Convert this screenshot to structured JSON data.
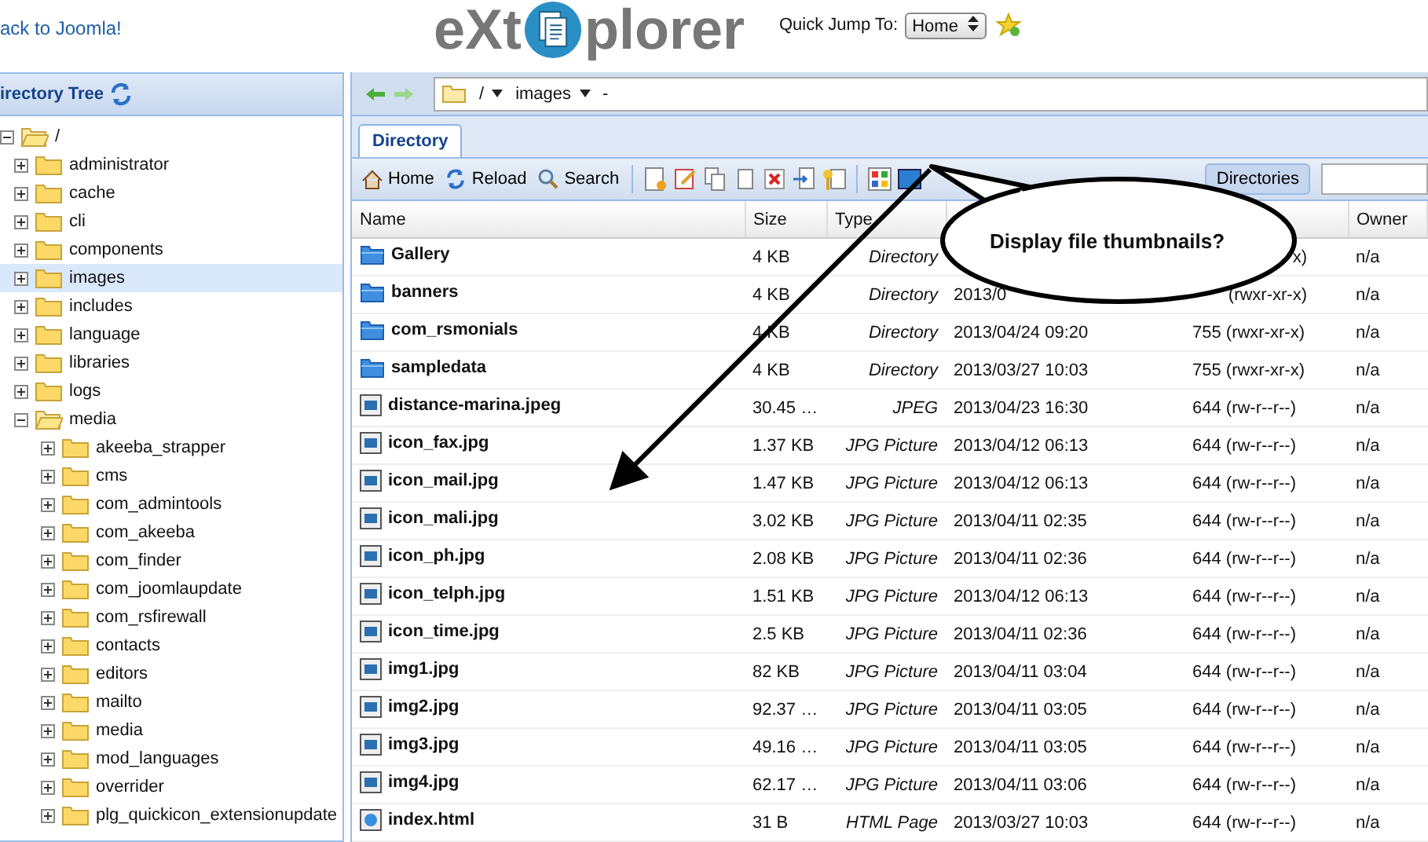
{
  "header": {
    "back_link": "ack to Joomla!",
    "logo_left": "eXt",
    "logo_right": "plorer",
    "quick_jump_label": "Quick Jump To:",
    "quick_jump_value": "Home"
  },
  "sidebar": {
    "title": "irectory Tree",
    "tree": {
      "label": "/",
      "expanded": true,
      "selected": false,
      "children": [
        {
          "label": "administrator",
          "expanded": false,
          "selected": false
        },
        {
          "label": "cache",
          "expanded": false,
          "selected": false
        },
        {
          "label": "cli",
          "expanded": false,
          "selected": false
        },
        {
          "label": "components",
          "expanded": false,
          "selected": false
        },
        {
          "label": "images",
          "expanded": false,
          "selected": true
        },
        {
          "label": "includes",
          "expanded": false,
          "selected": false
        },
        {
          "label": "language",
          "expanded": false,
          "selected": false
        },
        {
          "label": "libraries",
          "expanded": false,
          "selected": false
        },
        {
          "label": "logs",
          "expanded": false,
          "selected": false
        },
        {
          "label": "media",
          "expanded": true,
          "selected": false,
          "children": [
            {
              "label": "akeeba_strapper",
              "expanded": false,
              "selected": false
            },
            {
              "label": "cms",
              "expanded": false,
              "selected": false
            },
            {
              "label": "com_admintools",
              "expanded": false,
              "selected": false
            },
            {
              "label": "com_akeeba",
              "expanded": false,
              "selected": false
            },
            {
              "label": "com_finder",
              "expanded": false,
              "selected": false
            },
            {
              "label": "com_joomlaupdate",
              "expanded": false,
              "selected": false
            },
            {
              "label": "com_rsfirewall",
              "expanded": false,
              "selected": false
            },
            {
              "label": "contacts",
              "expanded": false,
              "selected": false
            },
            {
              "label": "editors",
              "expanded": false,
              "selected": false
            },
            {
              "label": "mailto",
              "expanded": false,
              "selected": false
            },
            {
              "label": "media",
              "expanded": false,
              "selected": false
            },
            {
              "label": "mod_languages",
              "expanded": false,
              "selected": false
            },
            {
              "label": "overrider",
              "expanded": false,
              "selected": false
            },
            {
              "label": "plg_quickicon_extensionupdate",
              "expanded": false,
              "selected": false
            }
          ]
        }
      ]
    }
  },
  "path_bar": {
    "segments": [
      "/",
      "images"
    ],
    "tail": "-"
  },
  "tabs": [
    {
      "label": "Directory",
      "selected": true
    }
  ],
  "toolbar": {
    "buttons": [
      "Home",
      "Reload",
      "Search"
    ],
    "toggle": "Directories"
  },
  "table": {
    "columns": {
      "name": "Name",
      "size": "Size",
      "type": "Type",
      "owner": "Owner"
    },
    "rows": [
      {
        "kind": "folder",
        "name": "Gallery",
        "size": "4 KB",
        "type": "Directory",
        "permissions": "x)",
        "permissions_cut": true,
        "owner": "n/a"
      },
      {
        "kind": "folder",
        "name": "banners",
        "size": "4 KB",
        "type": "Directory",
        "modified": "2013/0",
        "permissions": "(rwxr-xr-x)",
        "permissions_cut": true,
        "owner": "n/a"
      },
      {
        "kind": "folder",
        "name": "com_rsmonials",
        "size": "4 KB",
        "type": "Directory",
        "modified": "2013/04/24 09:20",
        "permissions": "755 (rwxr-xr-x)",
        "permissions_cut": false,
        "owner": "n/a"
      },
      {
        "kind": "folder",
        "name": "sampledata",
        "size": "4 KB",
        "type": "Directory",
        "modified": "2013/03/27 10:03",
        "permissions": "755 (rwxr-xr-x)",
        "permissions_cut": false,
        "owner": "n/a"
      },
      {
        "kind": "image",
        "name": "distance-marina.jpeg",
        "size": "30.45 …",
        "type": "JPEG",
        "modified": "2013/04/23 16:30",
        "permissions": "644 (rw-r--r--)",
        "permissions_cut": false,
        "owner": "n/a"
      },
      {
        "kind": "image",
        "name": "icon_fax.jpg",
        "size": "1.37 KB",
        "type": "JPG Picture",
        "modified": "2013/04/12 06:13",
        "permissions": "644 (rw-r--r--)",
        "permissions_cut": false,
        "owner": "n/a"
      },
      {
        "kind": "image",
        "name": "icon_mail.jpg",
        "size": "1.47 KB",
        "type": "JPG Picture",
        "modified": "2013/04/12 06:13",
        "permissions": "644 (rw-r--r--)",
        "permissions_cut": false,
        "owner": "n/a"
      },
      {
        "kind": "image",
        "name": "icon_mali.jpg",
        "size": "3.02 KB",
        "type": "JPG Picture",
        "modified": "2013/04/11 02:35",
        "permissions": "644 (rw-r--r--)",
        "permissions_cut": false,
        "owner": "n/a"
      },
      {
        "kind": "image",
        "name": "icon_ph.jpg",
        "size": "2.08 KB",
        "type": "JPG Picture",
        "modified": "2013/04/11 02:36",
        "permissions": "644 (rw-r--r--)",
        "permissions_cut": false,
        "owner": "n/a"
      },
      {
        "kind": "image",
        "name": "icon_telph.jpg",
        "size": "1.51 KB",
        "type": "JPG Picture",
        "modified": "2013/04/12 06:13",
        "permissions": "644 (rw-r--r--)",
        "permissions_cut": false,
        "owner": "n/a"
      },
      {
        "kind": "image",
        "name": "icon_time.jpg",
        "size": "2.5 KB",
        "type": "JPG Picture",
        "modified": "2013/04/11 02:36",
        "permissions": "644 (rw-r--r--)",
        "permissions_cut": false,
        "owner": "n/a"
      },
      {
        "kind": "image",
        "name": "img1.jpg",
        "size": "82 KB",
        "type": "JPG Picture",
        "modified": "2013/04/11 03:04",
        "permissions": "644 (rw-r--r--)",
        "permissions_cut": false,
        "owner": "n/a"
      },
      {
        "kind": "image",
        "name": "img2.jpg",
        "size": "92.37 …",
        "type": "JPG Picture",
        "modified": "2013/04/11 03:05",
        "permissions": "644 (rw-r--r--)",
        "permissions_cut": false,
        "owner": "n/a"
      },
      {
        "kind": "image",
        "name": "img3.jpg",
        "size": "49.16 …",
        "type": "JPG Picture",
        "modified": "2013/04/11 03:05",
        "permissions": "644 (rw-r--r--)",
        "permissions_cut": false,
        "owner": "n/a"
      },
      {
        "kind": "image",
        "name": "img4.jpg",
        "size": "62.17 …",
        "type": "JPG Picture",
        "modified": "2013/04/11 03:06",
        "permissions": "644 (rw-r--r--)",
        "permissions_cut": false,
        "owner": "n/a"
      },
      {
        "kind": "html",
        "name": "index.html",
        "size": "31 B",
        "type": "HTML Page",
        "modified": "2013/03/27 10:03",
        "permissions": "644 (rw-r--r--)",
        "permissions_cut": false,
        "owner": "n/a"
      }
    ]
  },
  "callout": {
    "text": "Display file thumbnails?"
  }
}
